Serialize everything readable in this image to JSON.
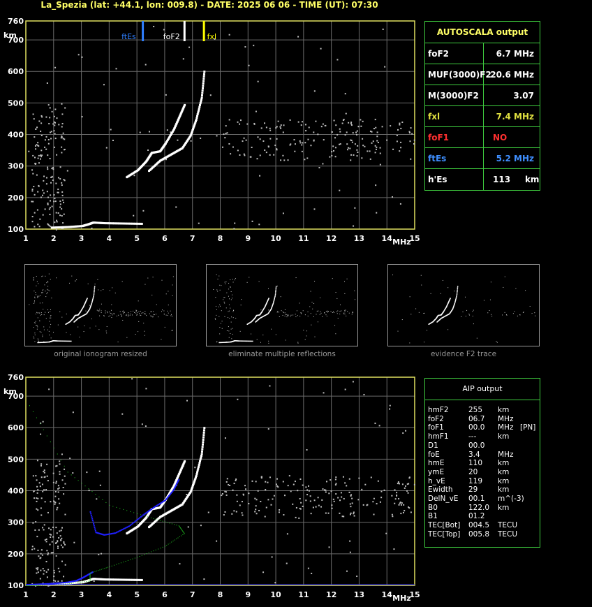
{
  "title": "La_Spezia (lat: +44.1, lon: 009.8) - DATE: 2025 06 06 - TIME (UT): 07:30",
  "chart_data": [
    {
      "type": "scatter",
      "title": "",
      "xlabel": "MHz",
      "ylabel": "km",
      "xlim": [
        1,
        15
      ],
      "ylim": [
        100,
        760
      ],
      "xticks": [
        "1",
        "2",
        "3",
        "4",
        "5",
        "6",
        "7",
        "8",
        "9",
        "10",
        "11",
        "12",
        "13",
        "14",
        "15"
      ],
      "yticks": [
        "100",
        "200",
        "300",
        "400",
        "500",
        "600",
        "700",
        "760"
      ],
      "grid": true,
      "markers": [
        {
          "label": "ftEs",
          "x": 5.2,
          "color": "#2f7fff"
        },
        {
          "label": "foF2",
          "x": 6.7,
          "color": "#ffffff"
        },
        {
          "label": "fxl",
          "x": 7.4,
          "color": "#ffff00"
        }
      ],
      "traces": [
        {
          "name": "E layer trace",
          "x": [
            1.9,
            2.5,
            3.0,
            3.2,
            3.4,
            3.8,
            4.5,
            5.2
          ],
          "y": [
            108,
            110,
            113,
            118,
            124,
            122,
            121,
            120
          ]
        },
        {
          "name": "O-mode F trace",
          "x": [
            4.6,
            5.0,
            5.3,
            5.5,
            5.8,
            6.0,
            6.3,
            6.5,
            6.7
          ],
          "y": [
            268,
            290,
            318,
            345,
            350,
            375,
            420,
            460,
            500
          ]
        },
        {
          "name": "X-mode F trace",
          "x": [
            5.4,
            5.8,
            6.2,
            6.6,
            6.9,
            7.1,
            7.3,
            7.4
          ],
          "y": [
            288,
            320,
            340,
            360,
            400,
            450,
            520,
            610
          ]
        }
      ]
    },
    {
      "type": "scatter",
      "title": "",
      "xlabel": "MHz",
      "ylabel": "km",
      "xlim": [
        1,
        15
      ],
      "ylim": [
        100,
        760
      ],
      "xticks": [
        "1",
        "2",
        "3",
        "4",
        "5",
        "6",
        "7",
        "8",
        "9",
        "10",
        "11",
        "12",
        "13",
        "14",
        "15"
      ],
      "yticks": [
        "100",
        "200",
        "300",
        "400",
        "500",
        "600",
        "700",
        "760"
      ],
      "grid": true,
      "traces": [
        {
          "name": "E layer trace",
          "x": [
            1.9,
            2.5,
            3.0,
            3.2,
            3.4,
            3.8,
            4.5,
            5.2
          ],
          "y": [
            108,
            110,
            113,
            118,
            124,
            122,
            121,
            120
          ]
        },
        {
          "name": "O-mode F trace",
          "x": [
            4.6,
            5.0,
            5.3,
            5.5,
            5.8,
            6.0,
            6.3,
            6.5,
            6.7
          ],
          "y": [
            268,
            290,
            318,
            345,
            350,
            375,
            420,
            460,
            500
          ]
        },
        {
          "name": "X-mode F trace",
          "x": [
            5.4,
            5.8,
            6.2,
            6.6,
            6.9,
            7.1,
            7.3,
            7.4
          ],
          "y": [
            288,
            320,
            340,
            360,
            400,
            450,
            520,
            610
          ]
        },
        {
          "name": "AIP virtual height fit",
          "color": "#2020ff",
          "x": [
            3.3,
            3.5,
            3.8,
            4.2,
            4.7,
            5.2,
            5.6,
            6.0,
            6.3,
            6.5
          ],
          "y": [
            335,
            270,
            262,
            268,
            290,
            325,
            350,
            372,
            405,
            440
          ]
        },
        {
          "name": "AIP E fit",
          "color": "#2020ff",
          "x": [
            1.0,
            1.5,
            2.0,
            2.5,
            2.8,
            3.0,
            3.2,
            3.4
          ],
          "y": [
            104,
            106,
            108,
            112,
            117,
            125,
            135,
            145
          ]
        },
        {
          "name": "Electron density profile",
          "color": "#22cc22",
          "x": [
            1.0,
            1.5,
            2.5,
            3.3,
            3.3,
            4.0,
            5.0,
            6.0,
            6.7,
            6.5,
            5.5,
            4.0,
            2.5,
            1.0
          ],
          "y": [
            100,
            101,
            106,
            115,
            140,
            160,
            190,
            225,
            265,
            290,
            315,
            355,
            460,
            690
          ]
        }
      ]
    }
  ],
  "autoscala": {
    "header": "AUTOSCALA output",
    "rows": [
      {
        "label": "foF2",
        "value": "6.7 MHz",
        "label_color": "#ffffff",
        "value_color": "#ffffff"
      },
      {
        "label": "MUF(3000)F2",
        "value": "20.6 MHz",
        "label_color": "#ffffff",
        "value_color": "#ffffff"
      },
      {
        "label": "M(3000)F2",
        "value": "3.07",
        "label_color": "#ffffff",
        "value_color": "#ffffff"
      },
      {
        "label": "fxl",
        "value": "7.4 MHz",
        "label_color": "#e0e040",
        "value_color": "#e0e040"
      },
      {
        "label": "foF1",
        "value": "NO",
        "label_color": "#ff3030",
        "value_color": "#ff3030"
      },
      {
        "label": "ftEs",
        "value": "5.2 MHz",
        "label_color": "#3f8fff",
        "value_color": "#3f8fff"
      },
      {
        "label": "h'Es",
        "value": "113",
        "unit": "km",
        "label_color": "#ffffff",
        "value_color": "#ffffff"
      }
    ]
  },
  "aip": {
    "header": "AIP output",
    "rows": [
      {
        "k": "hmF2",
        "v": "255",
        "u": "km",
        "x": ""
      },
      {
        "k": "foF2",
        "v": "06.7",
        "u": "MHz",
        "x": ""
      },
      {
        "k": "foF1",
        "v": "00.0",
        "u": "MHz",
        "x": "[PN]"
      },
      {
        "k": "hmF1",
        "v": "---",
        "u": "km",
        "x": ""
      },
      {
        "k": "D1",
        "v": "00.0",
        "u": "",
        "x": ""
      },
      {
        "k": "foE",
        "v": "3.4",
        "u": "MHz",
        "x": ""
      },
      {
        "k": "hmE",
        "v": "110",
        "u": "km",
        "x": ""
      },
      {
        "k": "ymE",
        "v": "20",
        "u": "km",
        "x": ""
      },
      {
        "k": "h_vE",
        "v": "119",
        "u": "km",
        "x": ""
      },
      {
        "k": "Ewidth",
        "v": "29",
        "u": "km",
        "x": ""
      },
      {
        "k": "DelN_vE",
        "v": "00.1",
        "u": "m^(-3)",
        "x": ""
      },
      {
        "k": "B0",
        "v": "122.0",
        "u": "km",
        "x": ""
      },
      {
        "k": "B1",
        "v": "01.2",
        "u": "",
        "x": ""
      },
      {
        "k": "TEC[Bot]",
        "v": "004.5",
        "u": "TECU",
        "x": ""
      },
      {
        "k": "TEC[Top]",
        "v": "005.8",
        "u": "TECU",
        "x": ""
      }
    ]
  },
  "thumbnails": [
    {
      "caption": "original ionogram resized"
    },
    {
      "caption": "eliminate multiple reflections"
    },
    {
      "caption": "evidence F2 trace"
    }
  ]
}
